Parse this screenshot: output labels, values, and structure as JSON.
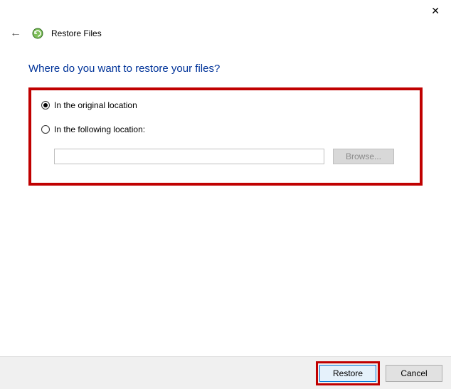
{
  "titlebar": {
    "close_glyph": "✕"
  },
  "header": {
    "back_glyph": "←",
    "title": "Restore Files"
  },
  "main": {
    "heading": "Where do you want to restore your files?",
    "options": {
      "original": {
        "label": "In the original location",
        "selected": true
      },
      "following": {
        "label": "In the following location:",
        "selected": false
      },
      "path_value": "",
      "browse_label": "Browse..."
    }
  },
  "footer": {
    "restore_label": "Restore",
    "cancel_label": "Cancel"
  }
}
